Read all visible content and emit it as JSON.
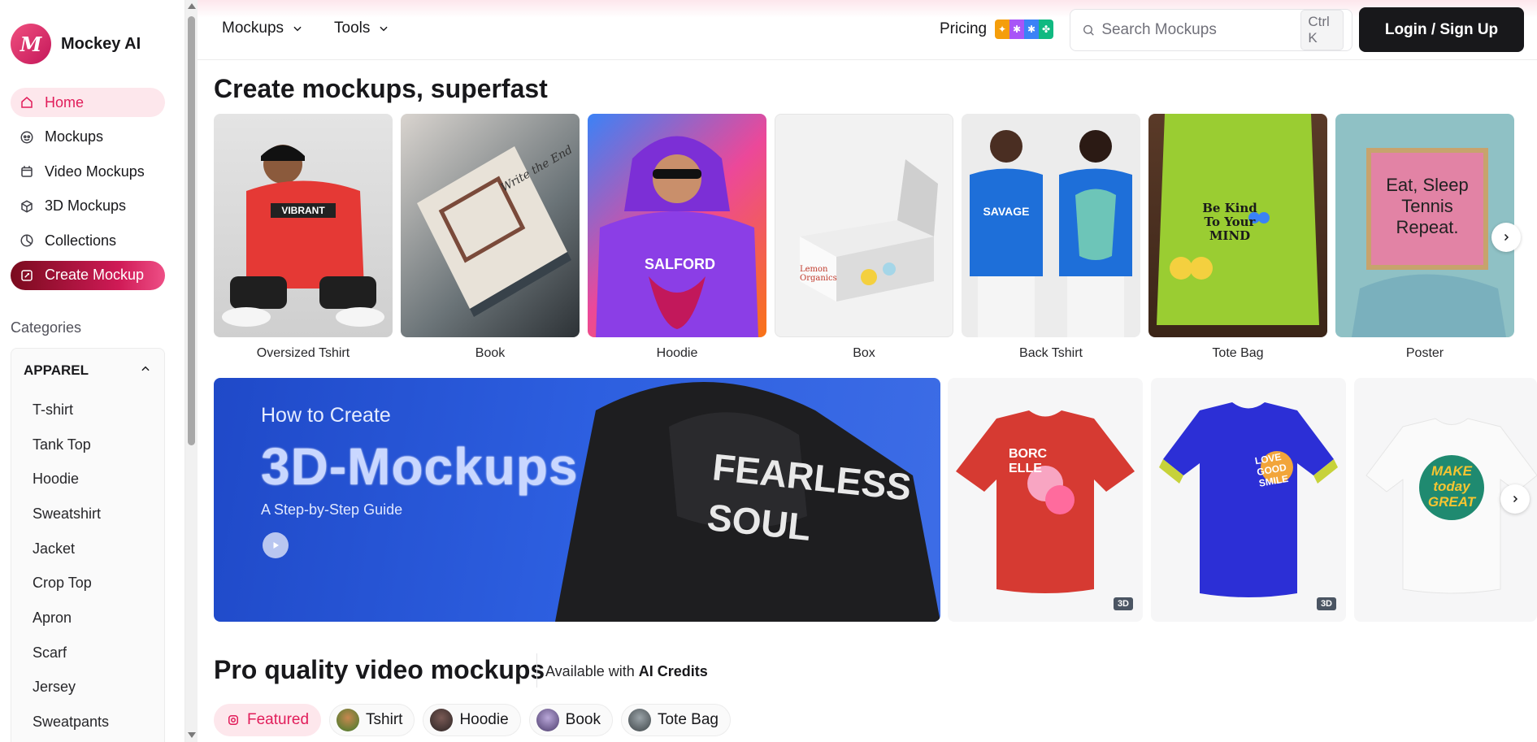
{
  "brand": {
    "name": "Mockey AI",
    "logo_letter": "M"
  },
  "sidebar": {
    "nav": [
      {
        "label": "Home",
        "icon": "home-icon"
      },
      {
        "label": "Mockups",
        "icon": "mockups-icon"
      },
      {
        "label": "Video Mockups",
        "icon": "video-icon"
      },
      {
        "label": "3D Mockups",
        "icon": "cube-icon"
      },
      {
        "label": "Collections",
        "icon": "collections-icon"
      },
      {
        "label": "Create Mockup",
        "icon": "edit-icon"
      }
    ],
    "categories_title": "Categories",
    "category_group": "APPAREL",
    "categories": [
      "T-shirt",
      "Tank Top",
      "Hoodie",
      "Sweatshirt",
      "Jacket",
      "Crop Top",
      "Apron",
      "Scarf",
      "Jersey",
      "Sweatpants"
    ]
  },
  "topbar": {
    "menu": [
      "Mockups",
      "Tools"
    ],
    "pricing": "Pricing",
    "search_placeholder": "Search Mockups",
    "search_shortcut": "Ctrl K",
    "login": "Login / Sign Up"
  },
  "main": {
    "heading": "Create mockups, superfast",
    "cards": [
      {
        "label": "Oversized Tshirt",
        "print": "VIBRANT"
      },
      {
        "label": "Book",
        "print": "Write the End"
      },
      {
        "label": "Hoodie",
        "print": "SALFORD"
      },
      {
        "label": "Box",
        "print": "Lemon Organics"
      },
      {
        "label": "Back Tshirt",
        "print": "SAVAGE"
      },
      {
        "label": "Tote Bag",
        "print": "Be Kind To Your MIND"
      },
      {
        "label": "Poster",
        "print": "Eat, Sleep Tennis Repeat."
      }
    ],
    "banner": {
      "kicker": "How to Create",
      "title": "3D-Mockups",
      "subtitle": "A Step-by-Step Guide",
      "hoodie_print": "FEARLESS SOUL"
    },
    "mockups_3d": [
      {
        "tag": "3D",
        "print": "BORC ELLE"
      },
      {
        "tag": "3D",
        "print": "LOVE GOOD SMILE"
      },
      {
        "tag": "",
        "print": "MAKE today GREAT"
      }
    ],
    "video_heading": "Pro quality video mockups",
    "available_prefix": "Available with",
    "available_bold": "AI Credits",
    "chips": [
      "Featured",
      "Tshirt",
      "Hoodie",
      "Book",
      "Tote Bag"
    ]
  },
  "colors": {
    "accent": "#e11d5a",
    "dark": "#18181b",
    "banner_blue": "#2d5fe0"
  }
}
